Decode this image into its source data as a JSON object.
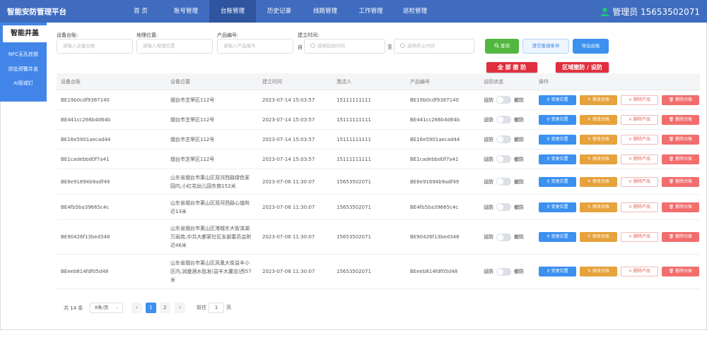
{
  "app": {
    "title": "智能安防管理平台"
  },
  "nav": [
    {
      "label": "首  页",
      "active": false
    },
    {
      "label": "账号管理",
      "active": false
    },
    {
      "label": "台账管理",
      "active": true
    },
    {
      "label": "历史记录",
      "active": false
    },
    {
      "label": "线路管理",
      "active": false
    },
    {
      "label": "工作管理",
      "active": false
    },
    {
      "label": "巡检管理",
      "active": false
    }
  ],
  "user": {
    "label": "管理员 15653502071",
    "icon": "user-icon"
  },
  "sidebar": {
    "title": "智能井盖",
    "items": [
      {
        "label": "NFC无孔挂锁"
      },
      {
        "label": "防坠预警井盖"
      },
      {
        "label": "AI管或钉"
      }
    ]
  },
  "filters": {
    "device_label": "设备台账:",
    "device_placeholder": "请输入设备台账",
    "location_label": "地理位置:",
    "location_placeholder": "请输入地理位置",
    "product_label": "产品编号:",
    "product_placeholder": "请输入产品编号",
    "time_label": "建立时间:",
    "time_from_prefix": "自",
    "time_start_placeholder": "选择起始时间",
    "time_to": "至",
    "time_end_placeholder": "选择终止时间",
    "query_label": "查询",
    "clear_label": "清空查询条件",
    "export_label": "导出台账"
  },
  "actions": {
    "disarm_all": "全 部 撤 防",
    "area_arm": "区域撤防 / 设防"
  },
  "table": {
    "headers": [
      "设备台账",
      "设备位置",
      "建立时间",
      "激活人",
      "产品编号",
      "设防状态",
      "操作"
    ],
    "switch_on_label": "设防",
    "switch_off_label": "撤防",
    "op_labels": [
      "变更位置",
      "修改台账",
      "删除产品",
      "删除台账"
    ],
    "rows": [
      {
        "device": "BE19b0cdf9387140",
        "location": "烟台市芝罘区112号",
        "time": "2023-07-14 15:03:57",
        "activator": "15111111111",
        "product": "BE19b0cdf9387140"
      },
      {
        "device": "BE441cc266b4d64b",
        "location": "烟台市芝罘区112号",
        "time": "2023-07-14 15:03:57",
        "activator": "15111111111",
        "product": "BE441cc266b4d64b"
      },
      {
        "device": "BE16e5901aecad44",
        "location": "烟台市芝罘区112号",
        "time": "2023-07-14 15:03:57",
        "activator": "15111111111",
        "product": "BE16e5901aecad44"
      },
      {
        "device": "BE1cadebbd0f7a41",
        "location": "烟台市芝罘区112号",
        "time": "2023-07-14 15:03:57",
        "activator": "15111111111",
        "product": "BE1cadebbd0f7a41"
      },
      {
        "device": "BE6e91694b9adf49",
        "location": "山东省烟台市莱山区双河西路绿色家园内,小红花幼儿园东南152米",
        "time": "2023-07-06 11:30:07",
        "activator": "15653502071",
        "product": "BE6e91694b9adf49"
      },
      {
        "device": "BE4fb5ba39665c4c",
        "location": "山东省烟台市莱山区双河西路心值附近13米",
        "time": "2023-07-06 11:30:07",
        "activator": "15653502071",
        "product": "BE4fb5ba39665c4c"
      },
      {
        "device": "BE90426f13bed348",
        "location": "山东省烟台市莱山区港城东大街滨湖万丽苑,中共大都家社区支部委员会附近46米",
        "time": "2023-07-06 11:30:07",
        "activator": "15653502071",
        "product": "BE90426f13bed348"
      },
      {
        "device": "BEeeb814fdf05d48",
        "location": "山东省烟台市莱山区凤凰大街益丰小区内,润盛酒水批发(益丰大厦店)西57米",
        "time": "2023-07-06 11:30:07",
        "activator": "15653502071",
        "product": "BEeeb814fdf05d48"
      }
    ]
  },
  "pagination": {
    "total": "共 14 条",
    "page_size": "8条/页",
    "prev": "‹",
    "pages": [
      "1",
      "2"
    ],
    "current": "1",
    "next": "›",
    "goto_label": "前往",
    "goto_value": "1",
    "goto_unit": "页"
  }
}
